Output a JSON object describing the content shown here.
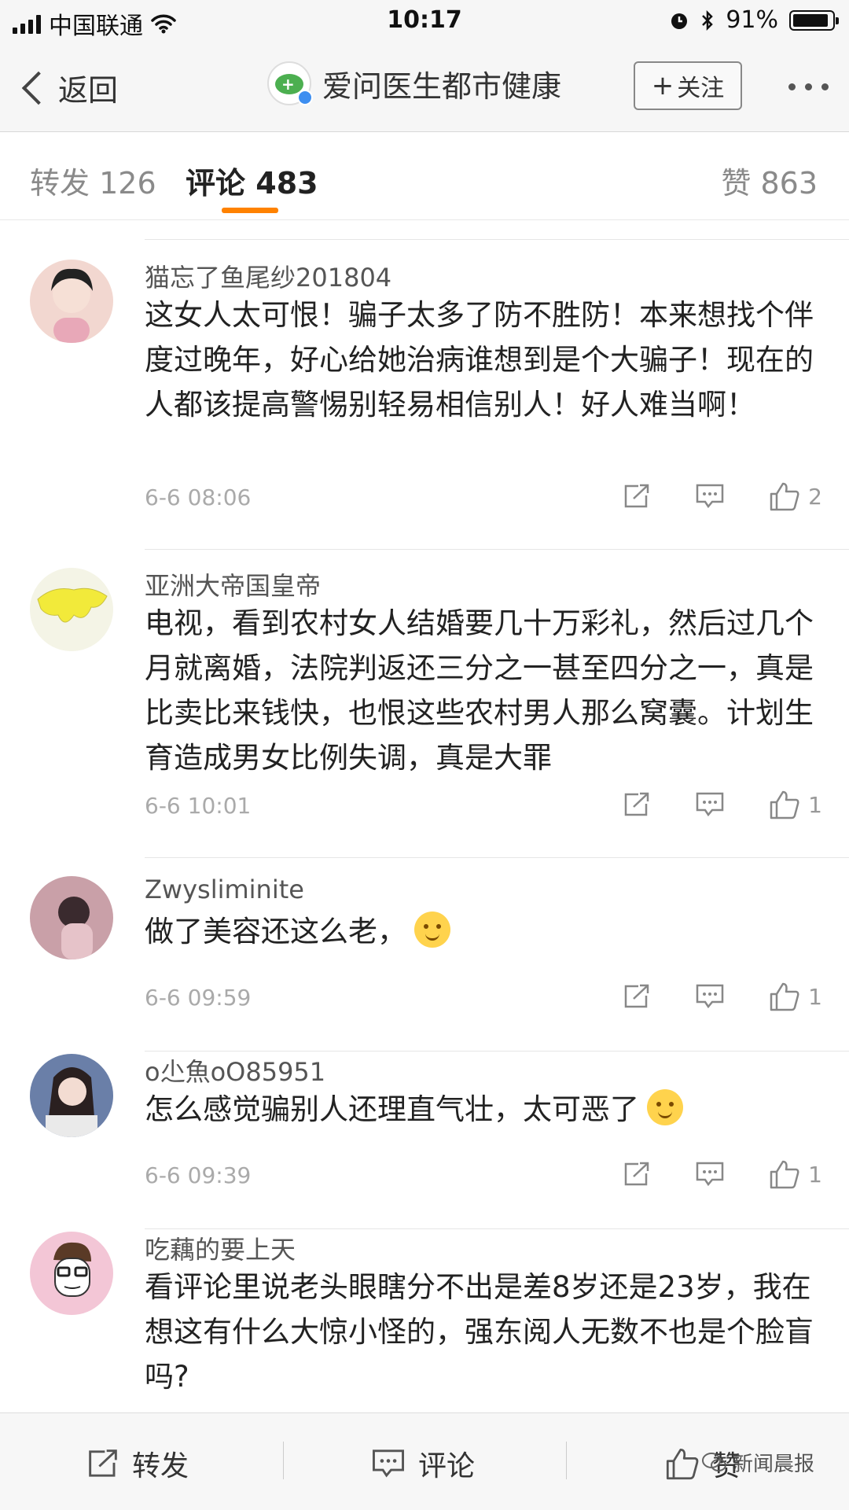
{
  "status": {
    "carrier": "中国联通",
    "time": "10:17",
    "battery": "91%",
    "battery_level": 0.91
  },
  "nav": {
    "back_label": "返回",
    "title": "爱问医生都市健康",
    "follow_label": "关注"
  },
  "tabs": {
    "repost_label": "转发",
    "repost_count": "126",
    "comment_label": "评论",
    "comment_count": "483",
    "like_label": "赞",
    "like_count": "863"
  },
  "comments": [
    {
      "username": "猫忘了鱼尾纱201804",
      "text": "这女人太可恨！骗子太多了防不胜防！本来想找个伴度过晚年，好心给她治病谁想到是个大骗子！现在的人都该提高警惕别轻易相信别人！好人难当啊！",
      "time": "6-6 08:06",
      "likes": "2",
      "avatar_color": "#f2d7d0"
    },
    {
      "username": "亚洲大帝国皇帝",
      "text": "电视，看到农村女人结婚要几十万彩礼，然后过几个月就离婚，法院判返还三分之一甚至四分之一，真是比卖比来钱快，也恨这些农村男人那么窝囊。计划生育造成男女比例失调，真是大罪",
      "time": "6-6 10:01",
      "likes": "1",
      "avatar_color": "#f4f4e6"
    },
    {
      "username": "Zwysliminite",
      "text": "做了美容还这么老，",
      "time": "6-6 09:59",
      "likes": "1",
      "avatar_color": "#c9a0a8"
    },
    {
      "username": "o尐魚oO85951",
      "text": "怎么感觉骗别人还理直气壮，太可恶了",
      "time": "6-6 09:39",
      "likes": "1",
      "avatar_color": "#6a7fa8"
    },
    {
      "username": "吃藕的要上天",
      "text": "看评论里说老头眼瞎分不出是差8岁还是23岁，我在想这有什么大惊小怪的，强东阅人无数不也是个脸盲吗?",
      "time": "",
      "likes": "",
      "avatar_color": "#f3c6d6"
    }
  ],
  "bottom": {
    "repost_label": "转发",
    "comment_label": "评论",
    "like_label": "赞"
  },
  "watermark": "新闻晨报",
  "icons": {
    "back": "chevron-left-icon",
    "more": "more-dots-icon",
    "share": "share-icon",
    "comment": "comment-icon",
    "like": "thumbs-up-icon"
  },
  "colors": {
    "accent": "#ff8200",
    "verified_badge": "#3d8ef0"
  }
}
